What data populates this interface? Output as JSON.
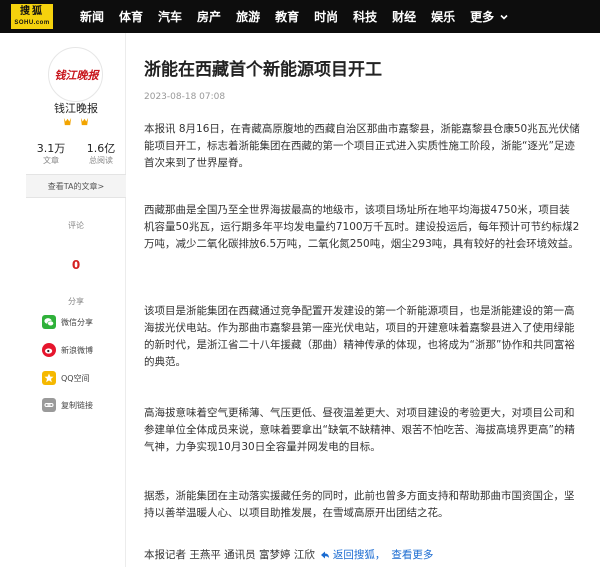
{
  "brand": {
    "logo_cn": "搜狐",
    "logo_en": "SOHU.com",
    "accent": "#f5d20d",
    "nav_bg": "#0d0d0d"
  },
  "nav": {
    "items": [
      "新闻",
      "体育",
      "汽车",
      "房产",
      "旅游",
      "教育",
      "时尚",
      "科技",
      "财经",
      "娱乐"
    ],
    "more_label": "更多"
  },
  "author": {
    "avatar_text": "钱江晚报",
    "name": "钱江晚报",
    "medal_icons": [
      "medal-icon",
      "medal-icon"
    ],
    "stats": [
      {
        "value": "3.1万",
        "label": "文章"
      },
      {
        "value": "1.6亿",
        "label": "总阅读"
      }
    ],
    "view_all": "查看TA的文章>"
  },
  "comments": {
    "title": "评论",
    "count": "0"
  },
  "share": {
    "title": "分享",
    "items": [
      {
        "label": "微信分享",
        "icon": "wechat-icon"
      },
      {
        "label": "新浪微博",
        "icon": "weibo-icon"
      },
      {
        "label": "QQ空间",
        "icon": "qzone-icon"
      },
      {
        "label": "复制链接",
        "icon": "link-icon"
      }
    ]
  },
  "article": {
    "title": "浙能在西藏首个新能源项目开工",
    "date": "2023-08-18 07:08",
    "paragraphs": [
      "本报讯 8月16日，在青藏高原腹地的西藏自治区那曲市嘉黎县，浙能嘉黎县仓康50兆瓦光伏储能项目开工，标志着浙能集团在西藏的第一个项目正式进入实质性施工阶段，浙能“逐光”足迹首次来到了世界屋脊。",
      "西藏那曲是全国乃至全世界海拔最高的地级市，该项目场址所在地平均海拔4750米，项目装机容量50兆瓦，运行期多年平均发电量约7100万千瓦时。建设投运后，每年预计可节约标煤2万吨，减少二氧化碳排放6.5万吨，二氧化氮250吨，烟尘293吨，具有较好的社会环境效益。",
      "该项目是浙能集团在西藏通过竞争配置开发建设的第一个新能源项目，也是浙能建设的第一高海拔光伏电站。作为那曲市嘉黎县第一座光伏电站，项目的开建意味着嘉黎县进入了使用绿能的新时代，是浙江省二十八年援藏（那曲）精神传承的体现，也将成为“浙那”协作和共同富裕的典范。",
      "高海拔意味着空气更稀薄、气压更低、昼夜温差更大、对项目建设的考验更大，对项目公司和参建单位全体成员来说，意味着要拿出“缺氧不缺精神、艰苦不怕吃苦、海拔高境界更高”的精气神，力争实现10月30日全容量并网发电的目标。",
      "据悉，浙能集团在主动落实援藏任务的同时，此前也曾多方面支持和帮助那曲市国资国企，坚持以善举温暖人心、以项目助推发展，在雪域高原开出团结之花。"
    ],
    "byline": "本报记者 王燕平 通讯员 富梦婷 江欣",
    "back_label": "返回搜狐，",
    "more_label": "查看更多"
  }
}
